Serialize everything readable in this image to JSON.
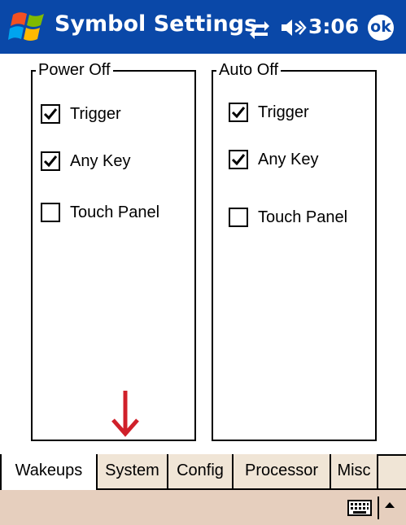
{
  "titlebar": {
    "app_title": "Symbol Settings",
    "clock": "3:06",
    "ok_label": "ok",
    "icons": [
      "windows-start-icon",
      "connectivity-icon",
      "speaker-icon"
    ]
  },
  "groups": {
    "power_off": {
      "title": "Power Off",
      "options": [
        {
          "label": "Trigger",
          "checked": true
        },
        {
          "label": "Any Key",
          "checked": true
        },
        {
          "label": "Touch Panel",
          "checked": false
        }
      ]
    },
    "auto_off": {
      "title": "Auto Off",
      "options": [
        {
          "label": "Trigger",
          "checked": true
        },
        {
          "label": "Any Key",
          "checked": true
        },
        {
          "label": "Touch Panel",
          "checked": false
        }
      ]
    }
  },
  "tabs": [
    {
      "label": "Wakeups",
      "active": true
    },
    {
      "label": "System",
      "active": false
    },
    {
      "label": "Config",
      "active": false
    },
    {
      "label": "Processor",
      "active": false
    },
    {
      "label": "Misc",
      "active": false
    }
  ],
  "menubar": {
    "icons": [
      "keyboard-icon",
      "sip-arrow-up-icon"
    ]
  },
  "colors": {
    "titlebar": "#0a48a8",
    "tabstrip": "#f0e5d6",
    "menubar": "#e6cfbe",
    "annotation_arrow": "#d0202a"
  }
}
